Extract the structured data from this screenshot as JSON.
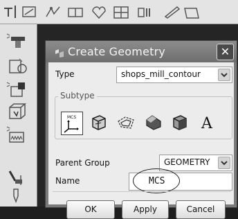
{
  "dialog": {
    "title": "Create Geometry",
    "close_glyph": "✕",
    "type_label": "Type",
    "type_value": "shops_mill_contour",
    "subtype_label": "Subtype",
    "subtype_mcs_label": "MCS",
    "subtype_text_glyph": "A",
    "parent_group_label": "Parent Group",
    "parent_group_value": "GEOMETRY",
    "name_label": "Name",
    "name_value": "MCS",
    "ok_label": "OK",
    "apply_label": "Apply",
    "cancel_label": "Cancel"
  },
  "colors": {
    "title_bar": "#7a7a7a",
    "dialog_bg": "#ececec",
    "workspace": "#252525",
    "toolbar": "#e4e4e4"
  }
}
